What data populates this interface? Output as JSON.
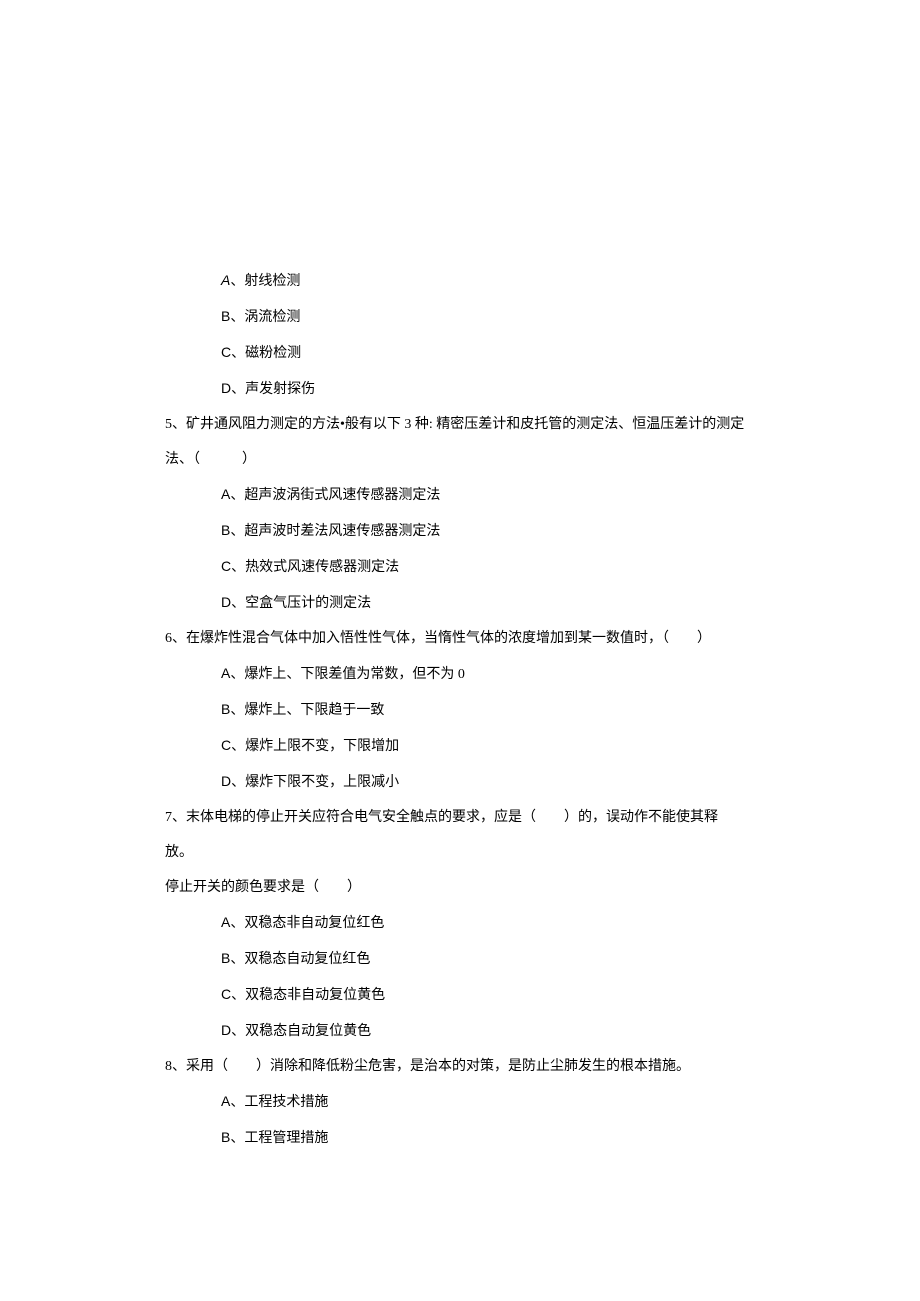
{
  "q4_prefix": {
    "optA_letter": "A",
    "optA_text": "、射线检测",
    "optB_letter": "B",
    "optB_text": "、涡流检测",
    "optC_letter": "C",
    "optC_text": "、磁粉检测",
    "optD_letter": "D",
    "optD_text": "、声发射探伤"
  },
  "q5": {
    "stem": "5、矿井通风阻力测定的方法•般有以下 3 种: 精密压差计和皮托管的测定法、恒温压差计的测定",
    "stem2": "法、（　　　）",
    "optA_letter": "A",
    "optA_text": "、超声波涡街式风速传感器测定法",
    "optB_letter": "B",
    "optB_text": "、超声波时差法风速传感器测定法",
    "optC_letter": "C",
    "optC_text": "、热效式风速传感器测定法",
    "optD_letter": "D",
    "optD_text": "、空盒气压计的测定法"
  },
  "q6": {
    "stem": "6、在爆炸性混合气体中加入悟性性气体，当惰性气体的浓度增加到某一数值时，（　　）",
    "optA_letter": "A",
    "optA_text": "、爆炸上、下限差值为常数，但不为 0",
    "optB_letter": "B",
    "optB_text": "、爆炸上、下限趋于一致",
    "optC_letter": "C",
    "optC_text": "、爆炸上限不变，下限增加",
    "optD_letter": "D",
    "optD_text": "、爆炸下限不变，上限减小"
  },
  "q7": {
    "stem": "7、末体电梯的停止开关应符合电气安全触点的要求，应是（　　）的，误动作不能使其释",
    "stem2": "放。",
    "extra": "停止开关的颜色要求是（　　）",
    "optA_letter": "A",
    "optA_text": "、双稳态非自动复位红色",
    "optB_letter": "B",
    "optB_text": "、双稳态自动复位红色",
    "optC_letter": "C",
    "optC_text": "、双稳态非自动复位黄色",
    "optD_letter": "D",
    "optD_text": "、双稳态自动复位黄色"
  },
  "q8": {
    "stem": "8、采用（　　）消除和降低粉尘危害，是治本的对策，是防止尘肺发生的根本措施。",
    "optA_letter": "A",
    "optA_text": "、工程技术措施",
    "optB_letter": "B",
    "optB_text": "、工程管理措施"
  }
}
